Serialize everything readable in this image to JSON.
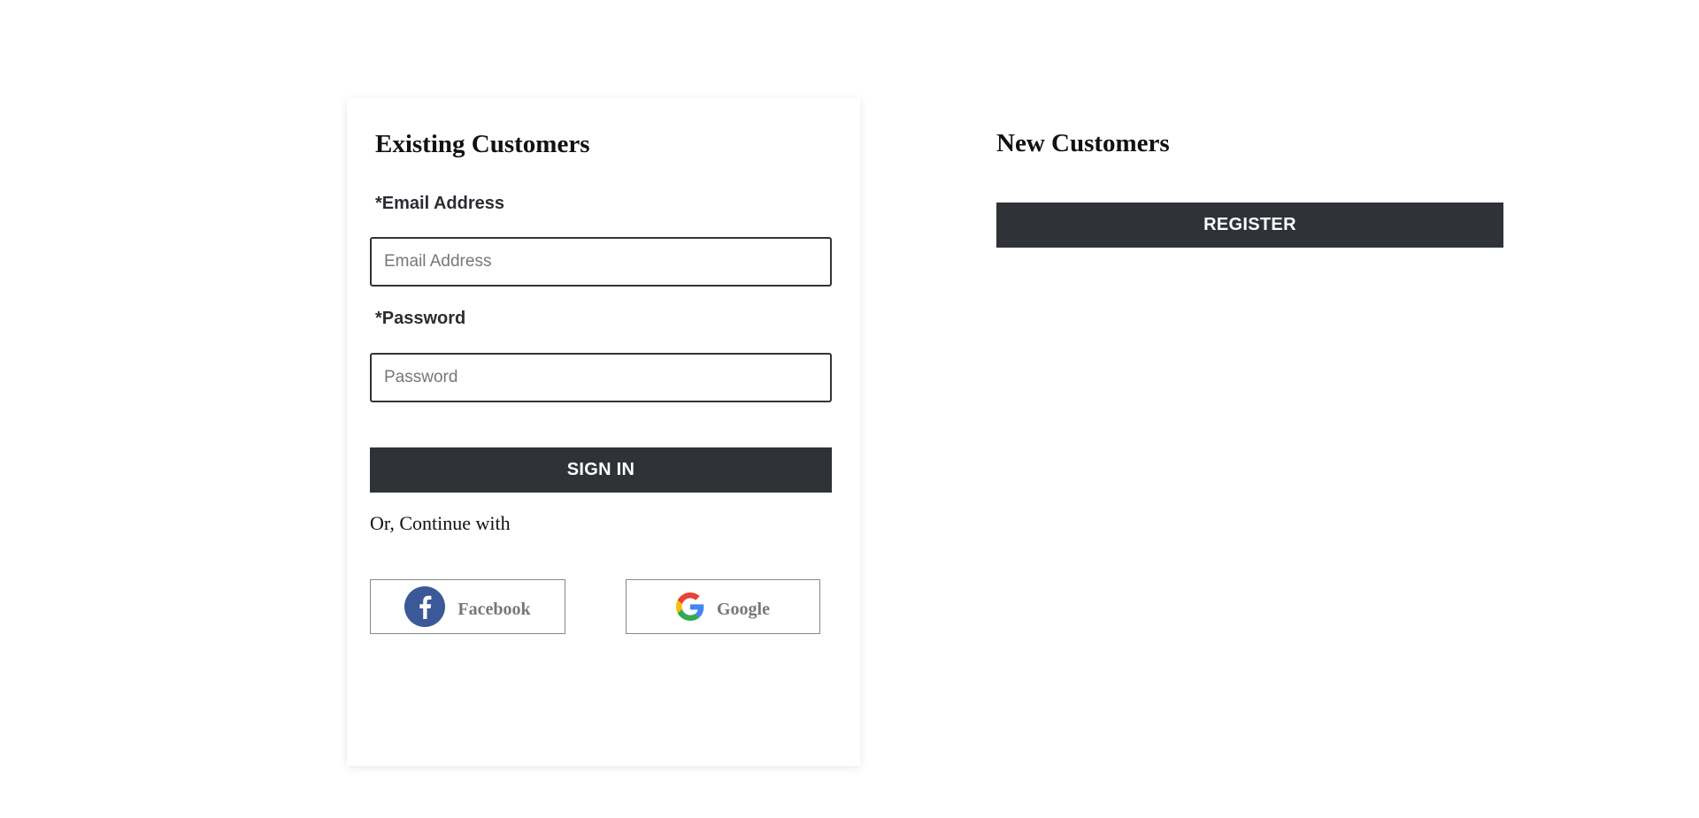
{
  "existing": {
    "title": "Existing Customers",
    "email_label": "*Email Address",
    "email_placeholder": "Email Address",
    "email_value": "",
    "password_label": "*Password",
    "password_placeholder": "Password",
    "password_value": "",
    "signin_label": "SIGN IN",
    "continue_text": "Or, Continue with",
    "social": {
      "facebook_label": "Facebook",
      "facebook_icon": "facebook-icon",
      "google_label": "Google",
      "google_icon": "google-icon"
    }
  },
  "new": {
    "title": "New Customers",
    "register_label": "REGISTER"
  },
  "colors": {
    "button_bg": "#2f3337",
    "facebook_blue": "#3b5998",
    "input_border": "#2f3437"
  }
}
